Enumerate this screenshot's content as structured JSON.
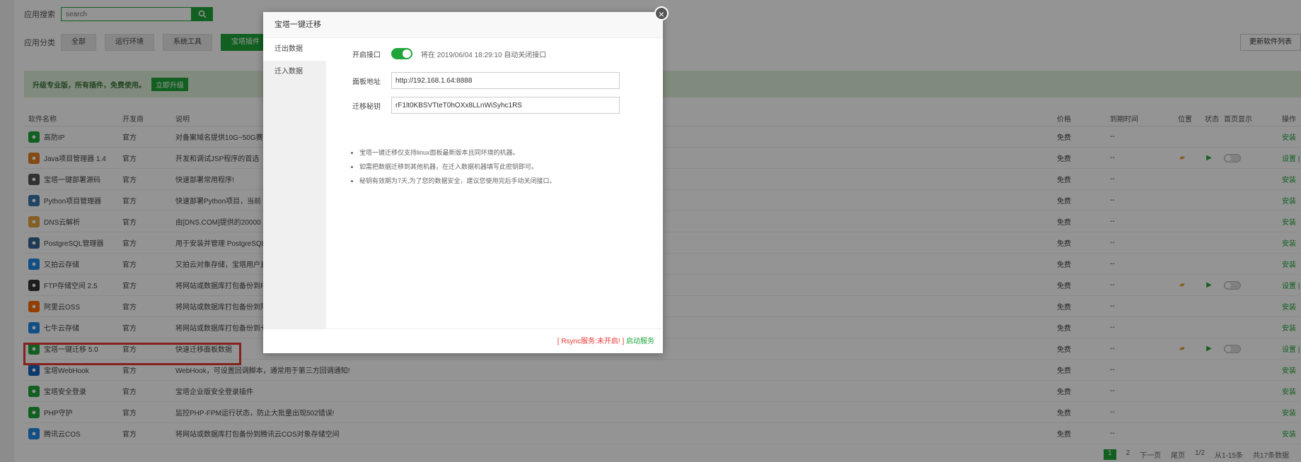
{
  "search": {
    "label": "应用搜索",
    "placeholder": "search"
  },
  "categories": {
    "label": "应用分类",
    "items": [
      "全部",
      "运行环境",
      "系统工具",
      "宝塔插件"
    ],
    "refresh": "更新软件列表"
  },
  "promo": {
    "text": "升级专业版，所有插件，免费使用。",
    "button": "立即升级"
  },
  "table": {
    "headers": [
      "软件名称",
      "开发商",
      "说明",
      "价格",
      "到期时间",
      "位置",
      "状态",
      "首页显示",
      "操作"
    ],
    "rows": [
      {
        "name": "高防IP",
        "dev": "官方",
        "desc": "对备案域名提供10G~50G赛",
        "price": "免费",
        "expire": "--",
        "op": "安装"
      },
      {
        "name": "Java项目管理器 1.4",
        "dev": "官方",
        "desc": "开发和调试JSP程序的首选",
        "price": "免费",
        "expire": "--",
        "op": "设置 | 卸载"
      },
      {
        "name": "宝塔一键部署源码",
        "dev": "官方",
        "desc": "快速部署常用程序!",
        "price": "免费",
        "expire": "--",
        "op": "安装"
      },
      {
        "name": "Python项目管理器",
        "dev": "官方",
        "desc": "快速部署Python项目，当前",
        "price": "免费",
        "expire": "--",
        "op": "安装"
      },
      {
        "name": "DNS云解析",
        "dev": "官方",
        "desc": "由[DNS.COM]提供的20000",
        "price": "免费",
        "expire": "--",
        "op": "安装"
      },
      {
        "name": "PostgreSQL管理器",
        "dev": "官方",
        "desc": "用于安装并管理 PostgreSQL",
        "price": "免费",
        "expire": "--",
        "op": "安装"
      },
      {
        "name": "又拍云存储",
        "dev": "官方",
        "desc": "又拍云对象存储，宝塔用户直",
        "price": "免费",
        "expire": "--",
        "op": "安装"
      },
      {
        "name": "FTP存储空间 2.5",
        "dev": "官方",
        "desc": "将网站或数据库打包备份到FT",
        "price": "免费",
        "expire": "--",
        "op": "设置 | 卸载"
      },
      {
        "name": "阿里云OSS",
        "dev": "官方",
        "desc": "将网站或数据库打包备份到阿",
        "price": "免费",
        "expire": "--",
        "op": "安装"
      },
      {
        "name": "七牛云存储",
        "dev": "官方",
        "desc": "将网站或数据库打包备份到七",
        "price": "免费",
        "expire": "--",
        "op": "安装"
      },
      {
        "name": "宝塔一键迁移 5.0",
        "dev": "官方",
        "desc": "快速迁移面板数据",
        "price": "免费",
        "expire": "--",
        "op": "设置 | 卸载"
      },
      {
        "name": "宝塔WebHook",
        "dev": "官方",
        "desc": "WebHook，可设置回调脚本，通常用于第三方回调通知!",
        "price": "免费",
        "expire": "--",
        "op": "安装"
      },
      {
        "name": "宝塔安全登录",
        "dev": "官方",
        "desc": "宝塔企业版安全登录插件",
        "price": "免费",
        "expire": "--",
        "op": "安装"
      },
      {
        "name": "PHP守护",
        "dev": "官方",
        "desc": "监控PHP-FPM运行状态，防止大批量出现502错误!",
        "price": "免费",
        "expire": "--",
        "op": "安装"
      },
      {
        "name": "腾讯云COS",
        "dev": "官方",
        "desc": "将网站或数据库打包备份到腾讯云COS对象存储空间",
        "price": "免费",
        "expire": "--",
        "op": "安装"
      }
    ]
  },
  "pager": {
    "items": [
      "1",
      "2",
      "下一页",
      "尾页",
      "1/2",
      "从1-15条",
      "共17条数据"
    ]
  },
  "modal": {
    "title": "宝塔一键迁移",
    "tabs": [
      "迁出数据",
      "迁入数据"
    ],
    "enable_label": "开启接口",
    "enable_hint": "将在 2019/06/04 18:29:10 自动关闭接口",
    "addr_label": "面板地址",
    "addr_value": "http://192.168.1.64:8888",
    "key_label": "迁移秘钥",
    "key_value": "rF1lt0KBSVTteT0hOXx8LLnWiSyhc1RS",
    "notes": [
      "宝塔一键迁移仅支持linux面板最新版本且同环境的机器。",
      "如需把数据迁移到其他机器，在迁入数据机器填写此密钥即可。",
      "秘钥有效期为7天,为了您的数据安全，建议您使用完后手动关闭接口。"
    ],
    "rsync_status": "[ Rsync服务:未开启! ]",
    "rsync_action": "启动服务"
  }
}
